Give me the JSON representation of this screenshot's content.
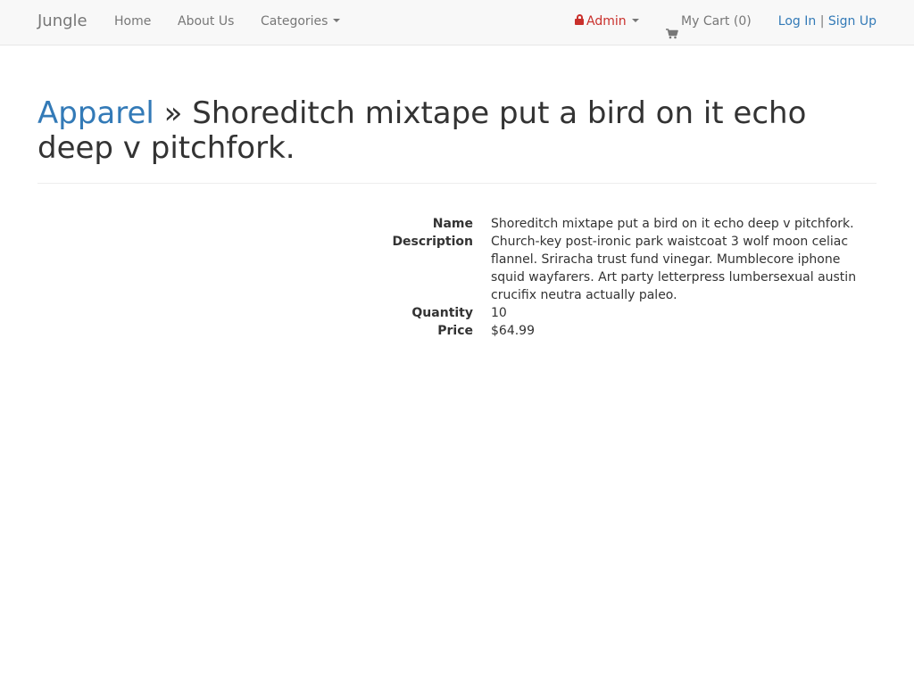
{
  "navbar": {
    "brand": "Jungle",
    "home": "Home",
    "about": "About Us",
    "categories": "Categories",
    "admin": "Admin",
    "cart": "My Cart (0)",
    "login": "Log In",
    "separator": "|",
    "signup": "Sign Up"
  },
  "header": {
    "category": "Apparel",
    "separator": "»",
    "product_name": "Shoreditch mixtape put a bird on it echo deep v pitchfork."
  },
  "details": [
    {
      "label": "Name",
      "value": "Shoreditch mixtape put a bird on it echo deep v pitchfork."
    },
    {
      "label": "Description",
      "value": "Church-key post-ironic park waistcoat 3 wolf moon celiac flannel. Sriracha trust fund vinegar. Mumblecore iphone squid wayfarers. Art party letterpress lumbersexual austin crucifix neutra actually paleo."
    },
    {
      "label": "Quantity",
      "value": "10"
    },
    {
      "label": "Price",
      "value": "$64.99"
    }
  ],
  "colors": {
    "link": "#337ab7",
    "admin_lock": "#c9302c",
    "nav_text": "#777777",
    "nav_bg": "#f8f8f8"
  },
  "icons": {
    "admin": "lock-icon",
    "cart": "shopping-cart-icon"
  }
}
